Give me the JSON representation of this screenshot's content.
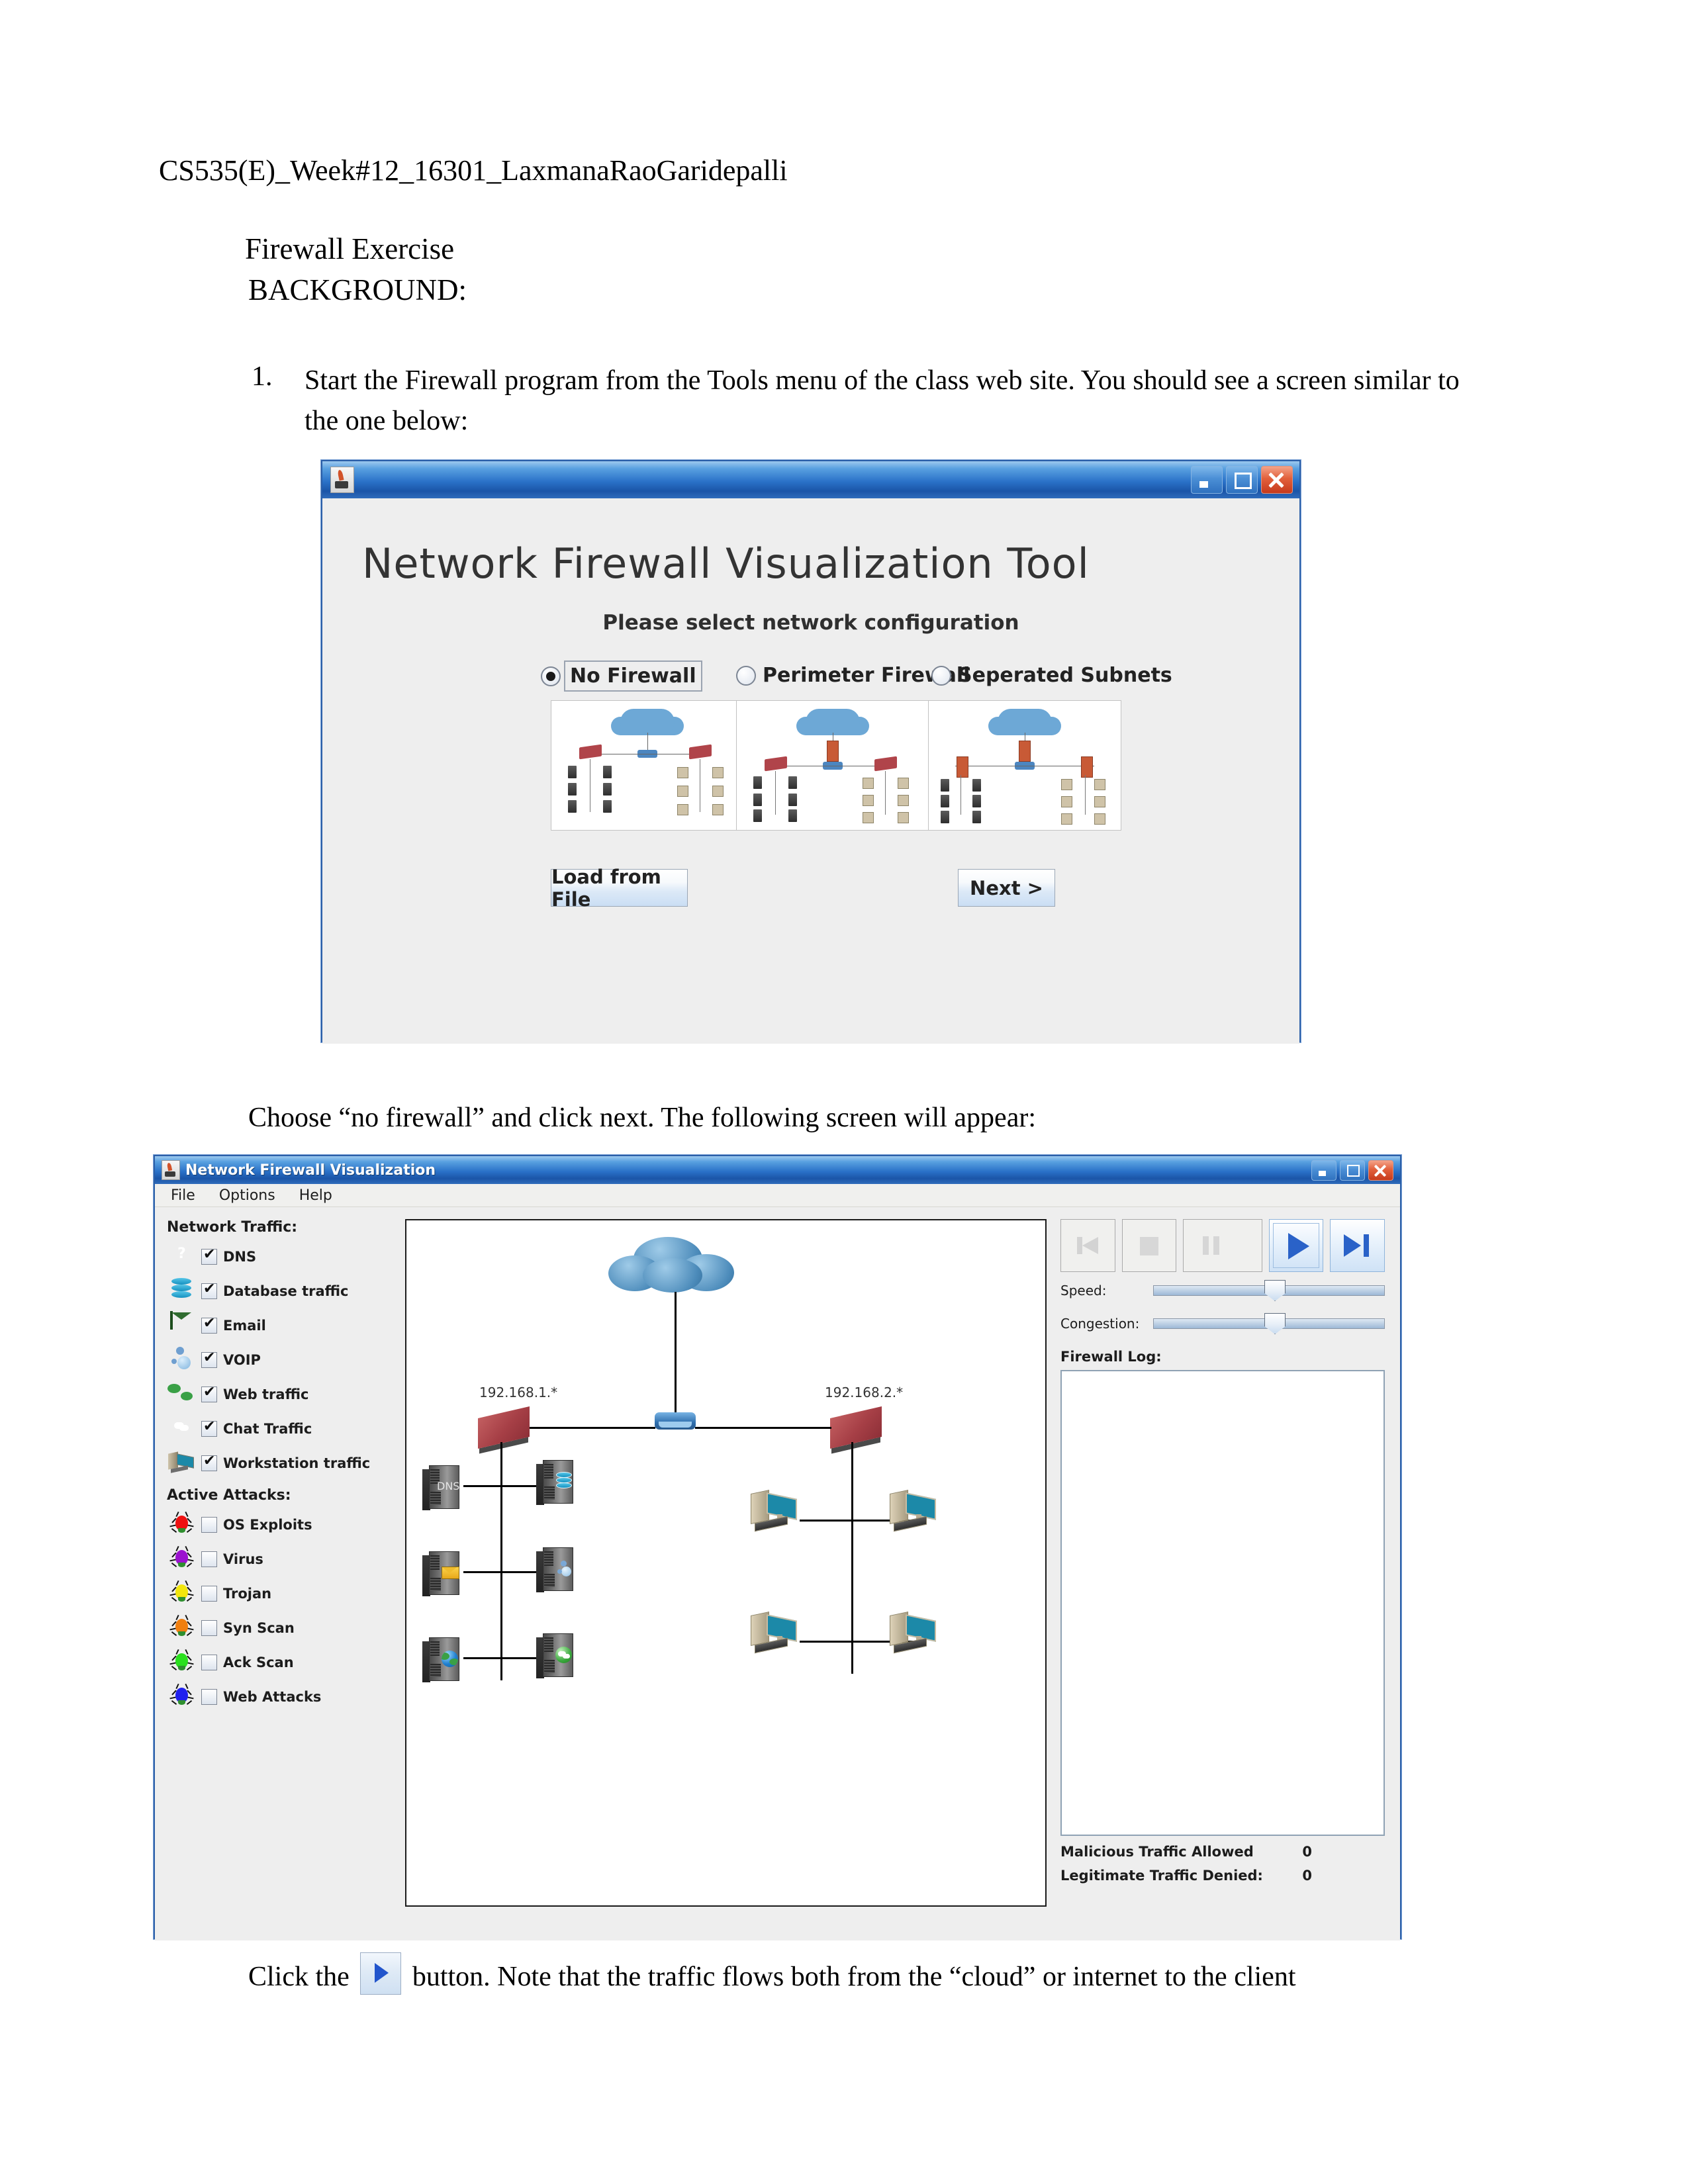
{
  "document": {
    "header": "CS535(E)_Week#12_16301_LaxmanaRaoGaridepalli",
    "title": "Firewall Exercise",
    "subtitle": "BACKGROUND:",
    "list_number": "1.",
    "list_text": "Start the Firewall program from the Tools menu of the class web site.  You should see a screen similar to the one below:",
    "caption_middle": "Choose “no firewall” and click next.  The following screen will appear:",
    "caption_bottom_before": "Click the",
    "caption_bottom_after": "button.  Note that the traffic flows both from the “cloud” or internet to the client"
  },
  "window1": {
    "titlebar": {
      "minimize": "Minimize",
      "maximize": "Maximize",
      "close": "Close"
    },
    "heading": "Network Firewall Visualization Tool",
    "subheading": "Please select network configuration",
    "options": [
      {
        "label": "No Firewall",
        "selected": true
      },
      {
        "label": "Perimeter Firewall",
        "selected": false
      },
      {
        "label": "Seperated Subnets",
        "selected": false
      }
    ],
    "buttons": {
      "load": "Load from File",
      "next": "Next >"
    }
  },
  "window2": {
    "title": "Network Firewall Visualization",
    "menu": [
      "File",
      "Options",
      "Help"
    ],
    "traffic_header": "Network Traffic:",
    "traffic": [
      {
        "label": "DNS",
        "checked": true,
        "icon": "dns-icon"
      },
      {
        "label": "Database traffic",
        "checked": true,
        "icon": "database-icon"
      },
      {
        "label": "Email",
        "checked": true,
        "icon": "envelope-icon"
      },
      {
        "label": "VOIP",
        "checked": true,
        "icon": "voip-icon"
      },
      {
        "label": "Web traffic",
        "checked": true,
        "icon": "globe-icon"
      },
      {
        "label": "Chat Traffic",
        "checked": true,
        "icon": "chat-icon"
      },
      {
        "label": "Workstation traffic",
        "checked": true,
        "icon": "workstation-icon"
      }
    ],
    "attacks_header": "Active Attacks:",
    "attacks": [
      {
        "label": "OS Exploits",
        "checked": false,
        "color": "#ee1111",
        "icon": "bug-icon"
      },
      {
        "label": "Virus",
        "checked": false,
        "color": "#9b12cf",
        "icon": "bug-icon"
      },
      {
        "label": "Trojan",
        "checked": false,
        "color": "#f2e60d",
        "icon": "bug-icon"
      },
      {
        "label": "Syn Scan",
        "checked": false,
        "color": "#f07f10",
        "icon": "bug-icon"
      },
      {
        "label": "Ack Scan",
        "checked": false,
        "color": "#2ae01e",
        "icon": "bug-icon"
      },
      {
        "label": "Web Attacks",
        "checked": false,
        "color": "#2020ee",
        "icon": "bug-icon"
      }
    ],
    "transport": [
      {
        "name": "skip-to-start",
        "enabled": false
      },
      {
        "name": "stop",
        "enabled": false
      },
      {
        "name": "pause",
        "enabled": false
      },
      {
        "name": "play",
        "enabled": true
      },
      {
        "name": "step-forward",
        "enabled": true
      }
    ],
    "sliders": [
      {
        "label": "Speed:",
        "value": 50
      },
      {
        "label": "Congestion:",
        "value": 50
      }
    ],
    "log_header": "Firewall Log:",
    "log_contents": "",
    "stats": [
      {
        "label": "Malicious Traffic Allowed",
        "value": "0"
      },
      {
        "label": "Legitimate Traffic Denied:",
        "value": "0"
      }
    ],
    "diagram": {
      "subnet_left_label": "192.168.1.*",
      "subnet_right_label": "192.168.2.*",
      "dns_label": "DNS",
      "servers": [
        "dns-server",
        "database-server",
        "email-server",
        "voip-server",
        "web-server",
        "chat-server"
      ],
      "workstations": 4
    }
  }
}
